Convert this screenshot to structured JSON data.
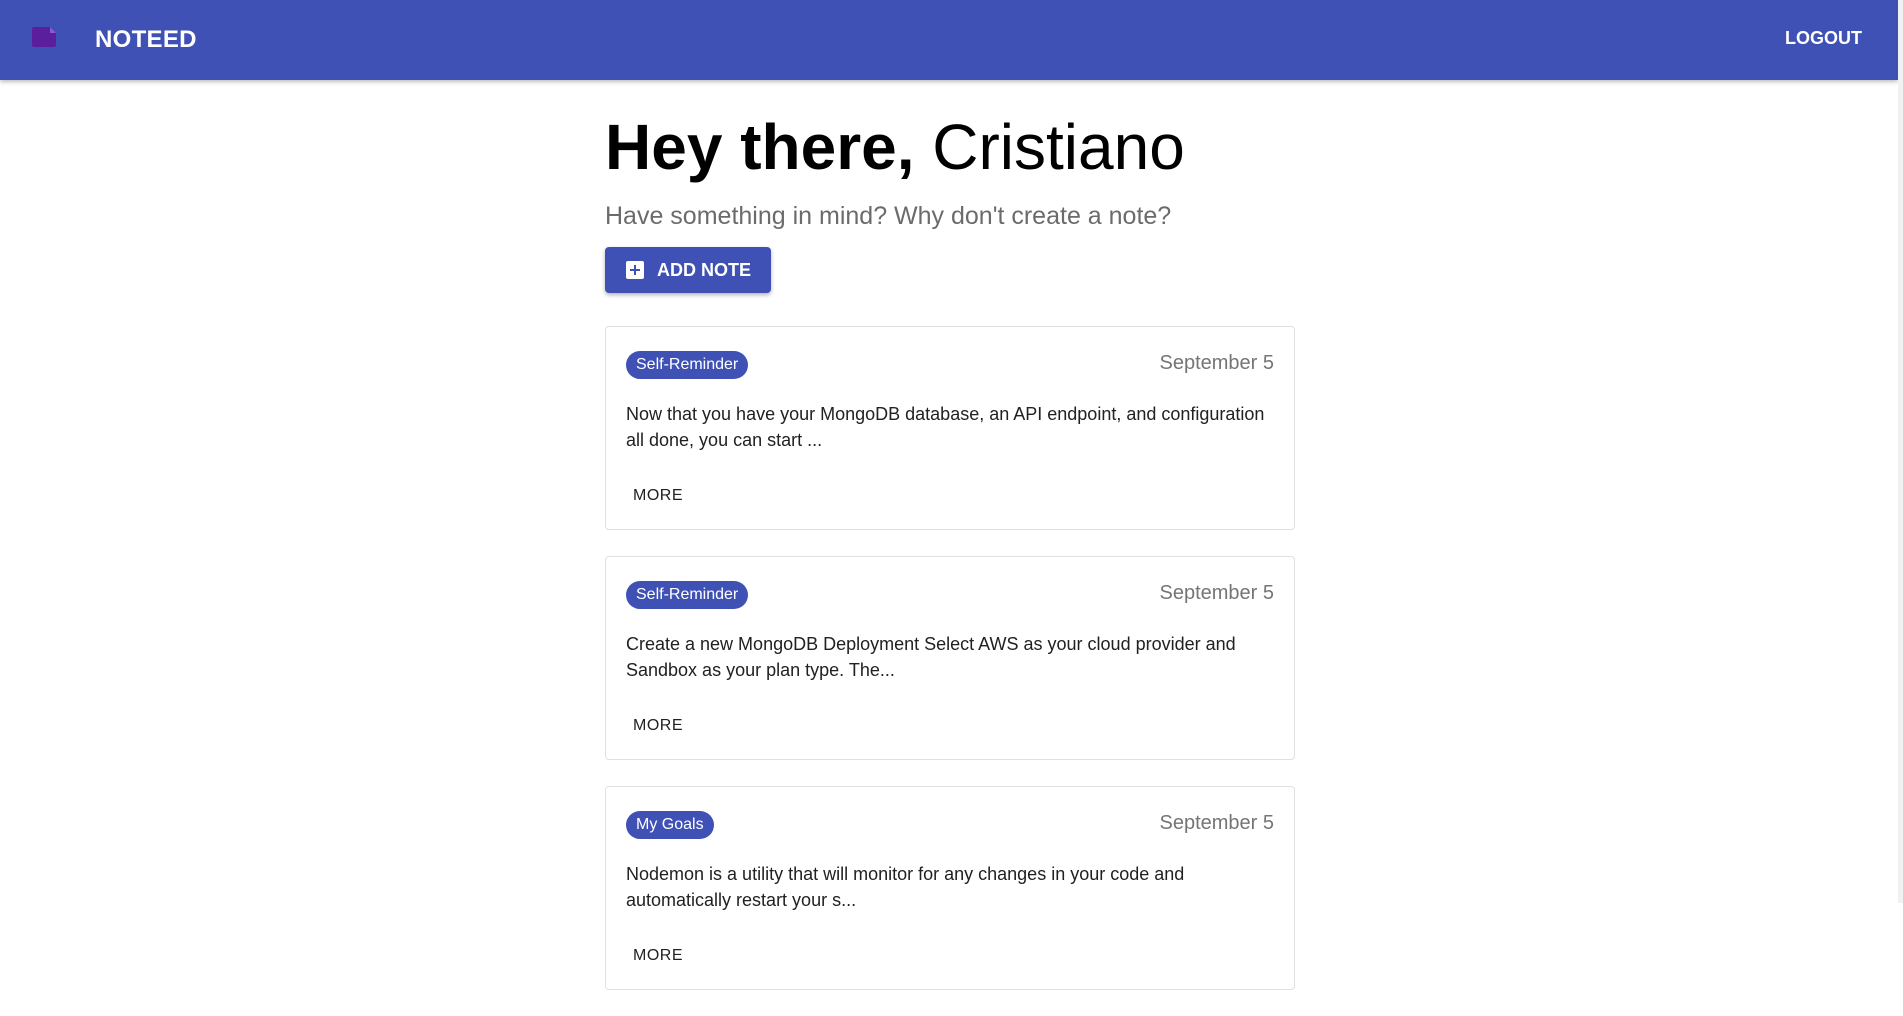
{
  "appbar": {
    "brand": "NOTEED",
    "logout_label": "LOGOUT",
    "brand_icon": "note-icon",
    "color": "#3f51b5"
  },
  "hero": {
    "greeting_bold": "Hey there,",
    "greeting_name": "Cristiano",
    "subtitle": "Have something in mind? Why don't create a note?",
    "add_button_label": "ADD NOTE",
    "add_button_icon": "add-box-icon"
  },
  "notes": [
    {
      "tag": "Self-Reminder",
      "date": "September 5",
      "body": "Now that you have your MongoDB database, an API endpoint, and configuration all done, you can start ...",
      "more_label": "MORE"
    },
    {
      "tag": "Self-Reminder",
      "date": "September 5",
      "body": "Create a new MongoDB Deployment Select AWS as your cloud provider and Sandbox as your plan type. The...",
      "more_label": "MORE"
    },
    {
      "tag": "My Goals",
      "date": "September 5",
      "body": "Nodemon is a utility that will monitor for any changes in your code and automatically restart your s...",
      "more_label": "MORE"
    }
  ]
}
